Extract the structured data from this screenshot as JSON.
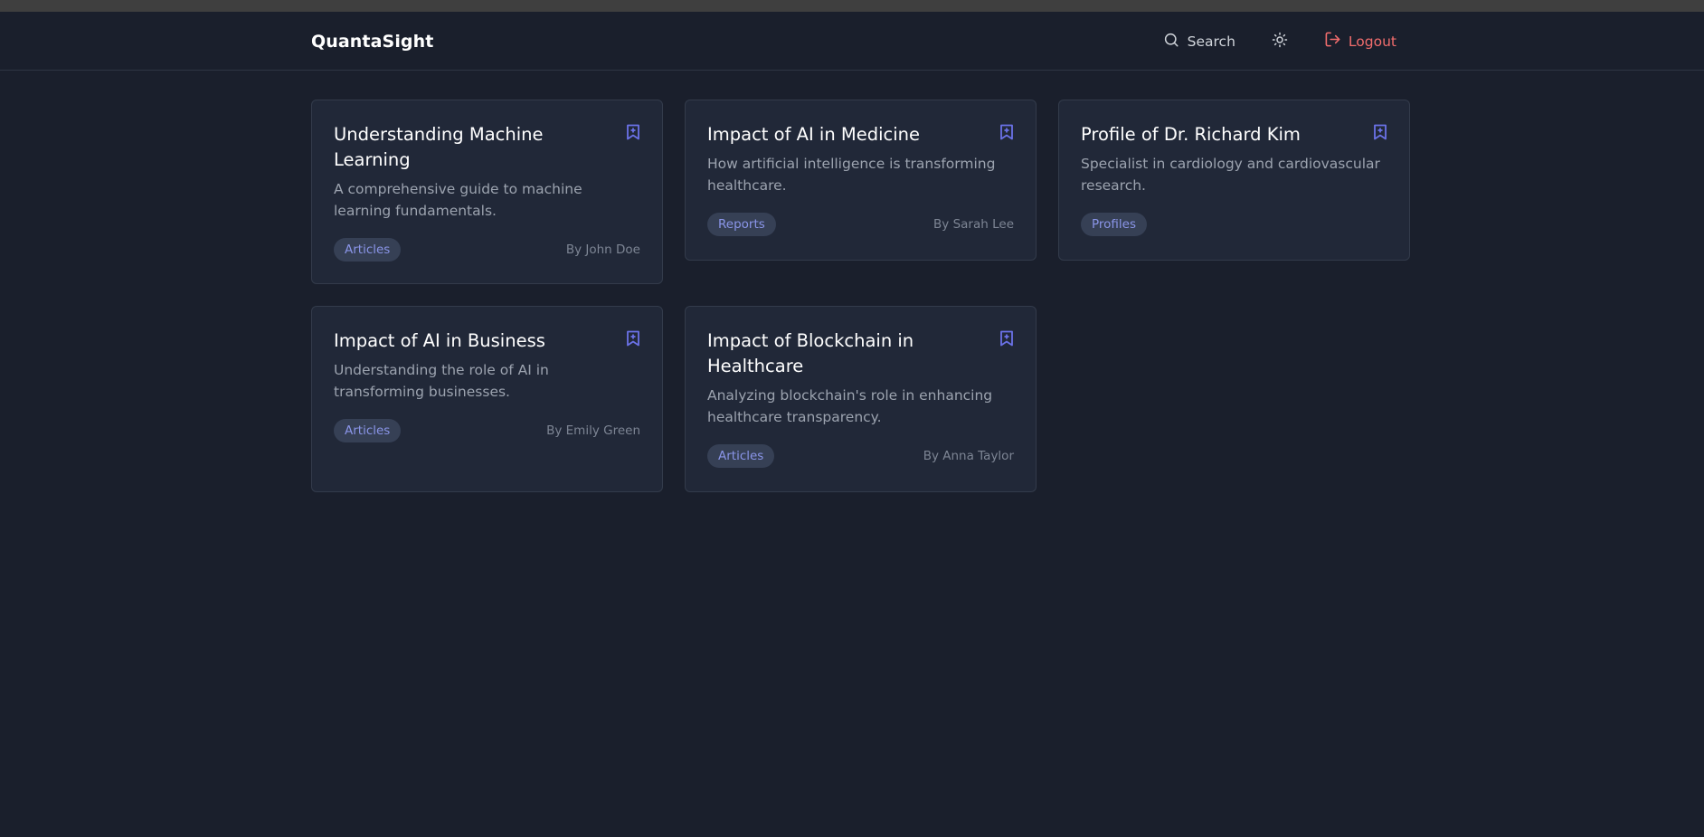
{
  "app": {
    "brand": "QuantaSight"
  },
  "nav": {
    "search_label": "Search",
    "search_icon": "search-icon",
    "theme_icon": "sun-icon",
    "logout_label": "Logout",
    "logout_icon": "logout-icon"
  },
  "colors": {
    "background": "#1a1f2c",
    "card": "#212838",
    "accent": "#6b72e8",
    "logout": "#f26d6d"
  },
  "cards": [
    {
      "title": "Understanding Machine Learning",
      "description": "A comprehensive guide to machine learning fundamentals.",
      "tag": "Articles",
      "author": "By John Doe"
    },
    {
      "title": "Impact of AI in Medicine",
      "description": "How artificial intelligence is transforming healthcare.",
      "tag": "Reports",
      "author": "By Sarah Lee"
    },
    {
      "title": "Profile of Dr. Richard Kim",
      "description": "Specialist in cardiology and cardiovascular research.",
      "tag": "Profiles",
      "author": ""
    },
    {
      "title": "Impact of AI in Business",
      "description": "Understanding the role of AI in transforming businesses.",
      "tag": "Articles",
      "author": "By Emily Green"
    },
    {
      "title": "Impact of Blockchain in Healthcare",
      "description": "Analyzing blockchain's role in enhancing healthcare transparency.",
      "tag": "Articles",
      "author": "By Anna Taylor"
    }
  ]
}
